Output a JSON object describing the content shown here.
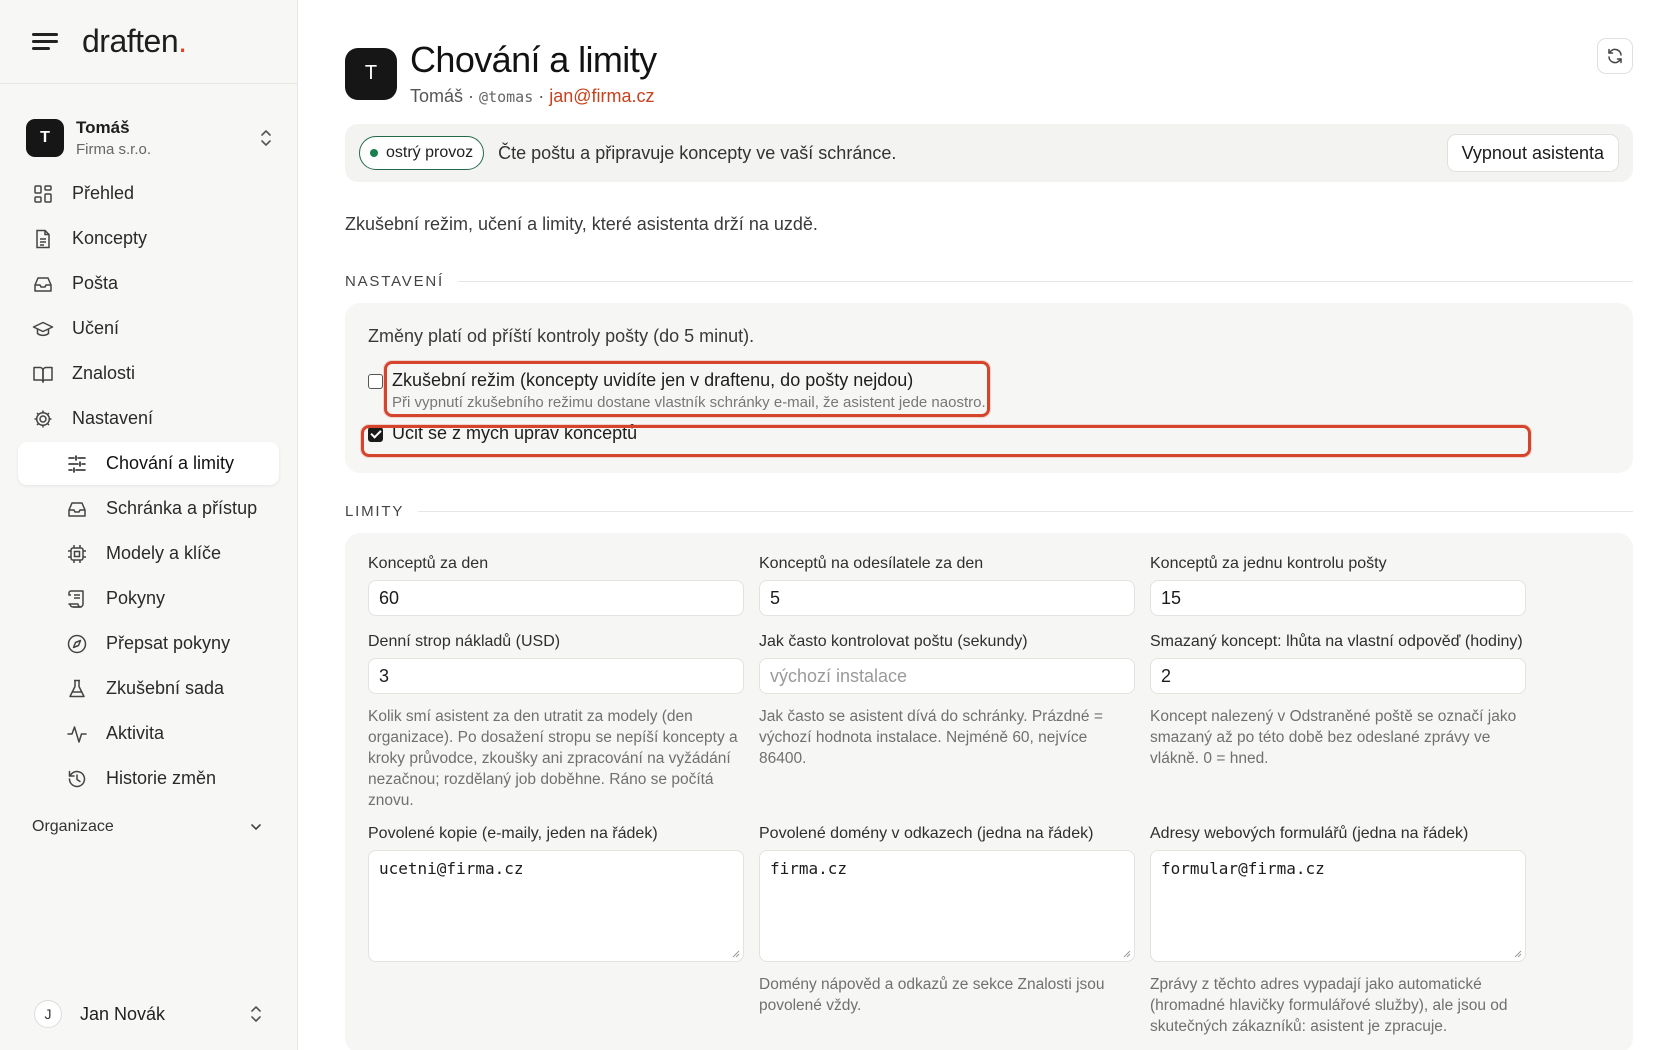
{
  "brand": {
    "name": "draften",
    "dot": "."
  },
  "org": {
    "avatar": "T",
    "name": "Tomáš",
    "company": "Firma s.r.o."
  },
  "nav": {
    "items": [
      {
        "label": "Přehled",
        "icon": "dashboard-icon"
      },
      {
        "label": "Koncepty",
        "icon": "document-icon"
      },
      {
        "label": "Pošta",
        "icon": "inbox-icon"
      },
      {
        "label": "Učení",
        "icon": "graduation-cap-icon"
      },
      {
        "label": "Znalosti",
        "icon": "book-icon"
      },
      {
        "label": "Nastavení",
        "icon": "gear-icon"
      }
    ],
    "subitems": [
      {
        "label": "Chování a limity",
        "icon": "sliders-icon",
        "active": true
      },
      {
        "label": "Schránka a přístup",
        "icon": "inbox-icon"
      },
      {
        "label": "Modely a klíče",
        "icon": "chip-icon"
      },
      {
        "label": "Pokyny",
        "icon": "scroll-icon"
      },
      {
        "label": "Přepsat pokyny",
        "icon": "compass-icon"
      },
      {
        "label": "Zkušební sada",
        "icon": "flask-icon"
      },
      {
        "label": "Aktivita",
        "icon": "activity-icon"
      },
      {
        "label": "Historie změn",
        "icon": "history-icon"
      }
    ],
    "group": "Organizace"
  },
  "user": {
    "avatar": "J",
    "name": "Jan Novák"
  },
  "header": {
    "avatar": "T",
    "title": "Chování a limity",
    "name": "Tomáš",
    "sep": "·",
    "handle": "@tomas",
    "email": "jan@firma.cz"
  },
  "status": {
    "pill": "ostrý provoz",
    "text": "Čte poštu a připravuje koncepty ve vaší schránce.",
    "button": "Vypnout asistenta"
  },
  "intro": "Zkušební režim, učení a limity, které asistenta drží na uzdě.",
  "settings": {
    "heading": "NASTAVENÍ",
    "note": "Změny platí od příští kontroly pošty (do 5 minut).",
    "trial": {
      "checked": false,
      "label": "Zkušební režim (koncepty uvidíte jen v draftenu, do pošty nejdou)",
      "hint": "Při vypnutí zkušebního režimu dostane vlastník schránky e-mail, že asistent jede naostro."
    },
    "learn": {
      "checked": true,
      "label": "Učit se z mých úprav konceptů"
    }
  },
  "limits": {
    "heading": "LIMITY",
    "row1": [
      {
        "label": "Konceptů za den",
        "value": "60"
      },
      {
        "label": "Konceptů na odesílatele za den",
        "value": "5"
      },
      {
        "label": "Konceptů za jednu kontrolu pošty",
        "value": "15"
      }
    ],
    "row2": [
      {
        "label": "Denní strop nákladů (USD)",
        "value": "3",
        "help": "Kolik smí asistent za den utratit za modely (den organizace). Po dosažení stropu se nepíší koncepty a kroky průvodce, zkoušky ani zpracování na vyžádání nezačnou; rozdělaný job doběhne. Ráno se počítá znovu."
      },
      {
        "label": "Jak často kontrolovat poštu (sekundy)",
        "placeholder": "výchozí instalace",
        "help": "Jak často se asistent dívá do schránky. Prázdné = výchozí hodnota instalace. Nejméně 60, nejvíce 86400."
      },
      {
        "label": "Smazaný koncept: lhůta na vlastní odpověď (hodiny)",
        "value": "2",
        "help": "Koncept nalezený v Odstraněné poště se označí jako smazaný až po této době bez odeslané zprávy ve vlákně. 0 = hned."
      }
    ],
    "row3": [
      {
        "label": "Povolené kopie (e-maily, jeden na řádek)",
        "value": "ucetni@firma.cz",
        "help": ""
      },
      {
        "label": "Povolené domény v odkazech (jedna na řádek)",
        "value": "firma.cz",
        "help": "Domény nápověd a odkazů ze sekce Znalosti jsou povolené vždy."
      },
      {
        "label": "Adresy webových formulářů (jedna na řádek)",
        "value": "formular@firma.cz",
        "help": "Zprávy z těchto adres vypadají jako automatické (hromadné hlavičky formulářové služby), ale jsou od skutečných zákazníků: asistent je zpracuje."
      }
    ]
  },
  "colors": {
    "accent": "#e0451f",
    "live": "#1a7f4f",
    "highlight": "#d5452d"
  }
}
